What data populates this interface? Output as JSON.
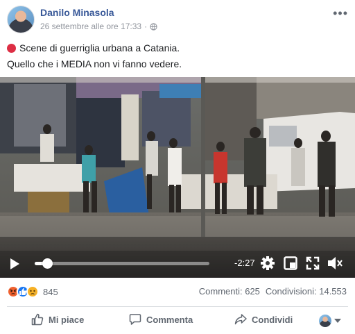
{
  "post": {
    "author": "Danilo Minasola",
    "timestamp": "26 settembre alle ore 17:33",
    "privacy_icon": "globe-icon",
    "more_icon": "more-options-icon",
    "text_line1": "Scene di guerriglia urbana a Catania.",
    "text_line2": "Quello che i MEDIA non vi fanno vedere.",
    "bullet_emoji": "red-circle"
  },
  "video": {
    "time_remaining": "-2:27",
    "progress": 0.07,
    "controls": [
      "play-icon",
      "settings-icon",
      "pip-icon",
      "fullscreen-icon",
      "volume-muted-icon"
    ]
  },
  "engagement": {
    "reactions": [
      "angry",
      "like",
      "sad"
    ],
    "reaction_count": "845",
    "comments": "Commenti: 625",
    "shares": "Condivisioni: 14.553"
  },
  "actions": {
    "like": "Mi piace",
    "comment": "Commenta",
    "share": "Condividi"
  },
  "colors": {
    "author_link": "#385898",
    "meta_gray": "#90949c",
    "action_gray": "#606770",
    "like_blue": "#1877f2",
    "angry_orange": "#f0612f",
    "sad_yellow": "#f7b125",
    "red_dot": "#dd2e44"
  }
}
